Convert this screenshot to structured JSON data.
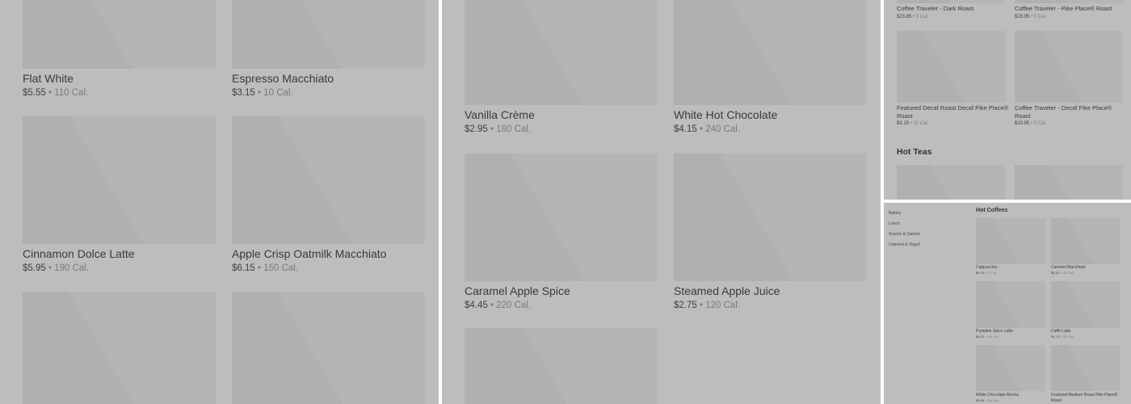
{
  "panel_a": {
    "items": [
      {
        "name": "Flat White",
        "price": "$5.55",
        "calories": "110 Cal."
      },
      {
        "name": "Espresso Macchiato",
        "price": "$3.15",
        "calories": "10 Cal."
      },
      {
        "name": "Cinnamon Dolce Latte",
        "price": "$5.95",
        "calories": "190 Cal."
      },
      {
        "name": "Apple Crisp Oatmilk Macchiato",
        "price": "$6.15",
        "calories": "150 Cal."
      }
    ]
  },
  "panel_b": {
    "items": [
      {
        "name": "Vanilla Crème",
        "price": "$2.95",
        "calories": "180 Cal."
      },
      {
        "name": "White Hot Chocolate",
        "price": "$4.15",
        "calories": "240 Cal."
      },
      {
        "name": "Caramel Apple Spice",
        "price": "$4.45",
        "calories": "220 Cal."
      },
      {
        "name": "Steamed Apple Juice",
        "price": "$2.75",
        "calories": "120 Cal."
      }
    ]
  },
  "panel_c": {
    "items": [
      {
        "name": "Coffee Traveler - Dark Roast",
        "price": "$23.95",
        "calories": "5 Cal."
      },
      {
        "name": "Coffee Traveler - Pike Place® Roast",
        "price": "$23.95",
        "calories": "5 Cal."
      },
      {
        "name": "Featured Decaf Roast Decaf Pike Place® Roast",
        "price": "$3.15",
        "calories": "10 Cal."
      },
      {
        "name": "Coffee Traveler - Decaf Pike Place® Roast",
        "price": "$23.95",
        "calories": "5 Cal."
      }
    ],
    "section_title": "Hot Teas"
  },
  "panel_d": {
    "sidebar": [
      "Bakery",
      "Lunch",
      "Snacks & Sweets",
      "Oatmeal & Yogurt"
    ],
    "section_title": "Hot Coffees",
    "items": [
      {
        "name": "Cappuccino",
        "price": "$4.75",
        "calories": "10 Cal."
      },
      {
        "name": "Caramel Macchiato",
        "price": "$5.15",
        "calories": "120 Cal."
      },
      {
        "name": "Pumpkin Spice Latte",
        "price": "$6.15",
        "calories": "110 Cal."
      },
      {
        "name": "Caffè Latte",
        "price": "$4.75",
        "calories": "100 Cal."
      },
      {
        "name": "White Chocolate Mocha",
        "price": "$5.95",
        "calories": "210 Cal."
      },
      {
        "name": "Featured Medium Roast Pike Place® Roast",
        "price": "",
        "calories": ""
      }
    ]
  },
  "separator": "•",
  "colors": {
    "overlay": "#bdbdbd",
    "tile": "#b0b0b0",
    "divider": "#ffffff"
  }
}
